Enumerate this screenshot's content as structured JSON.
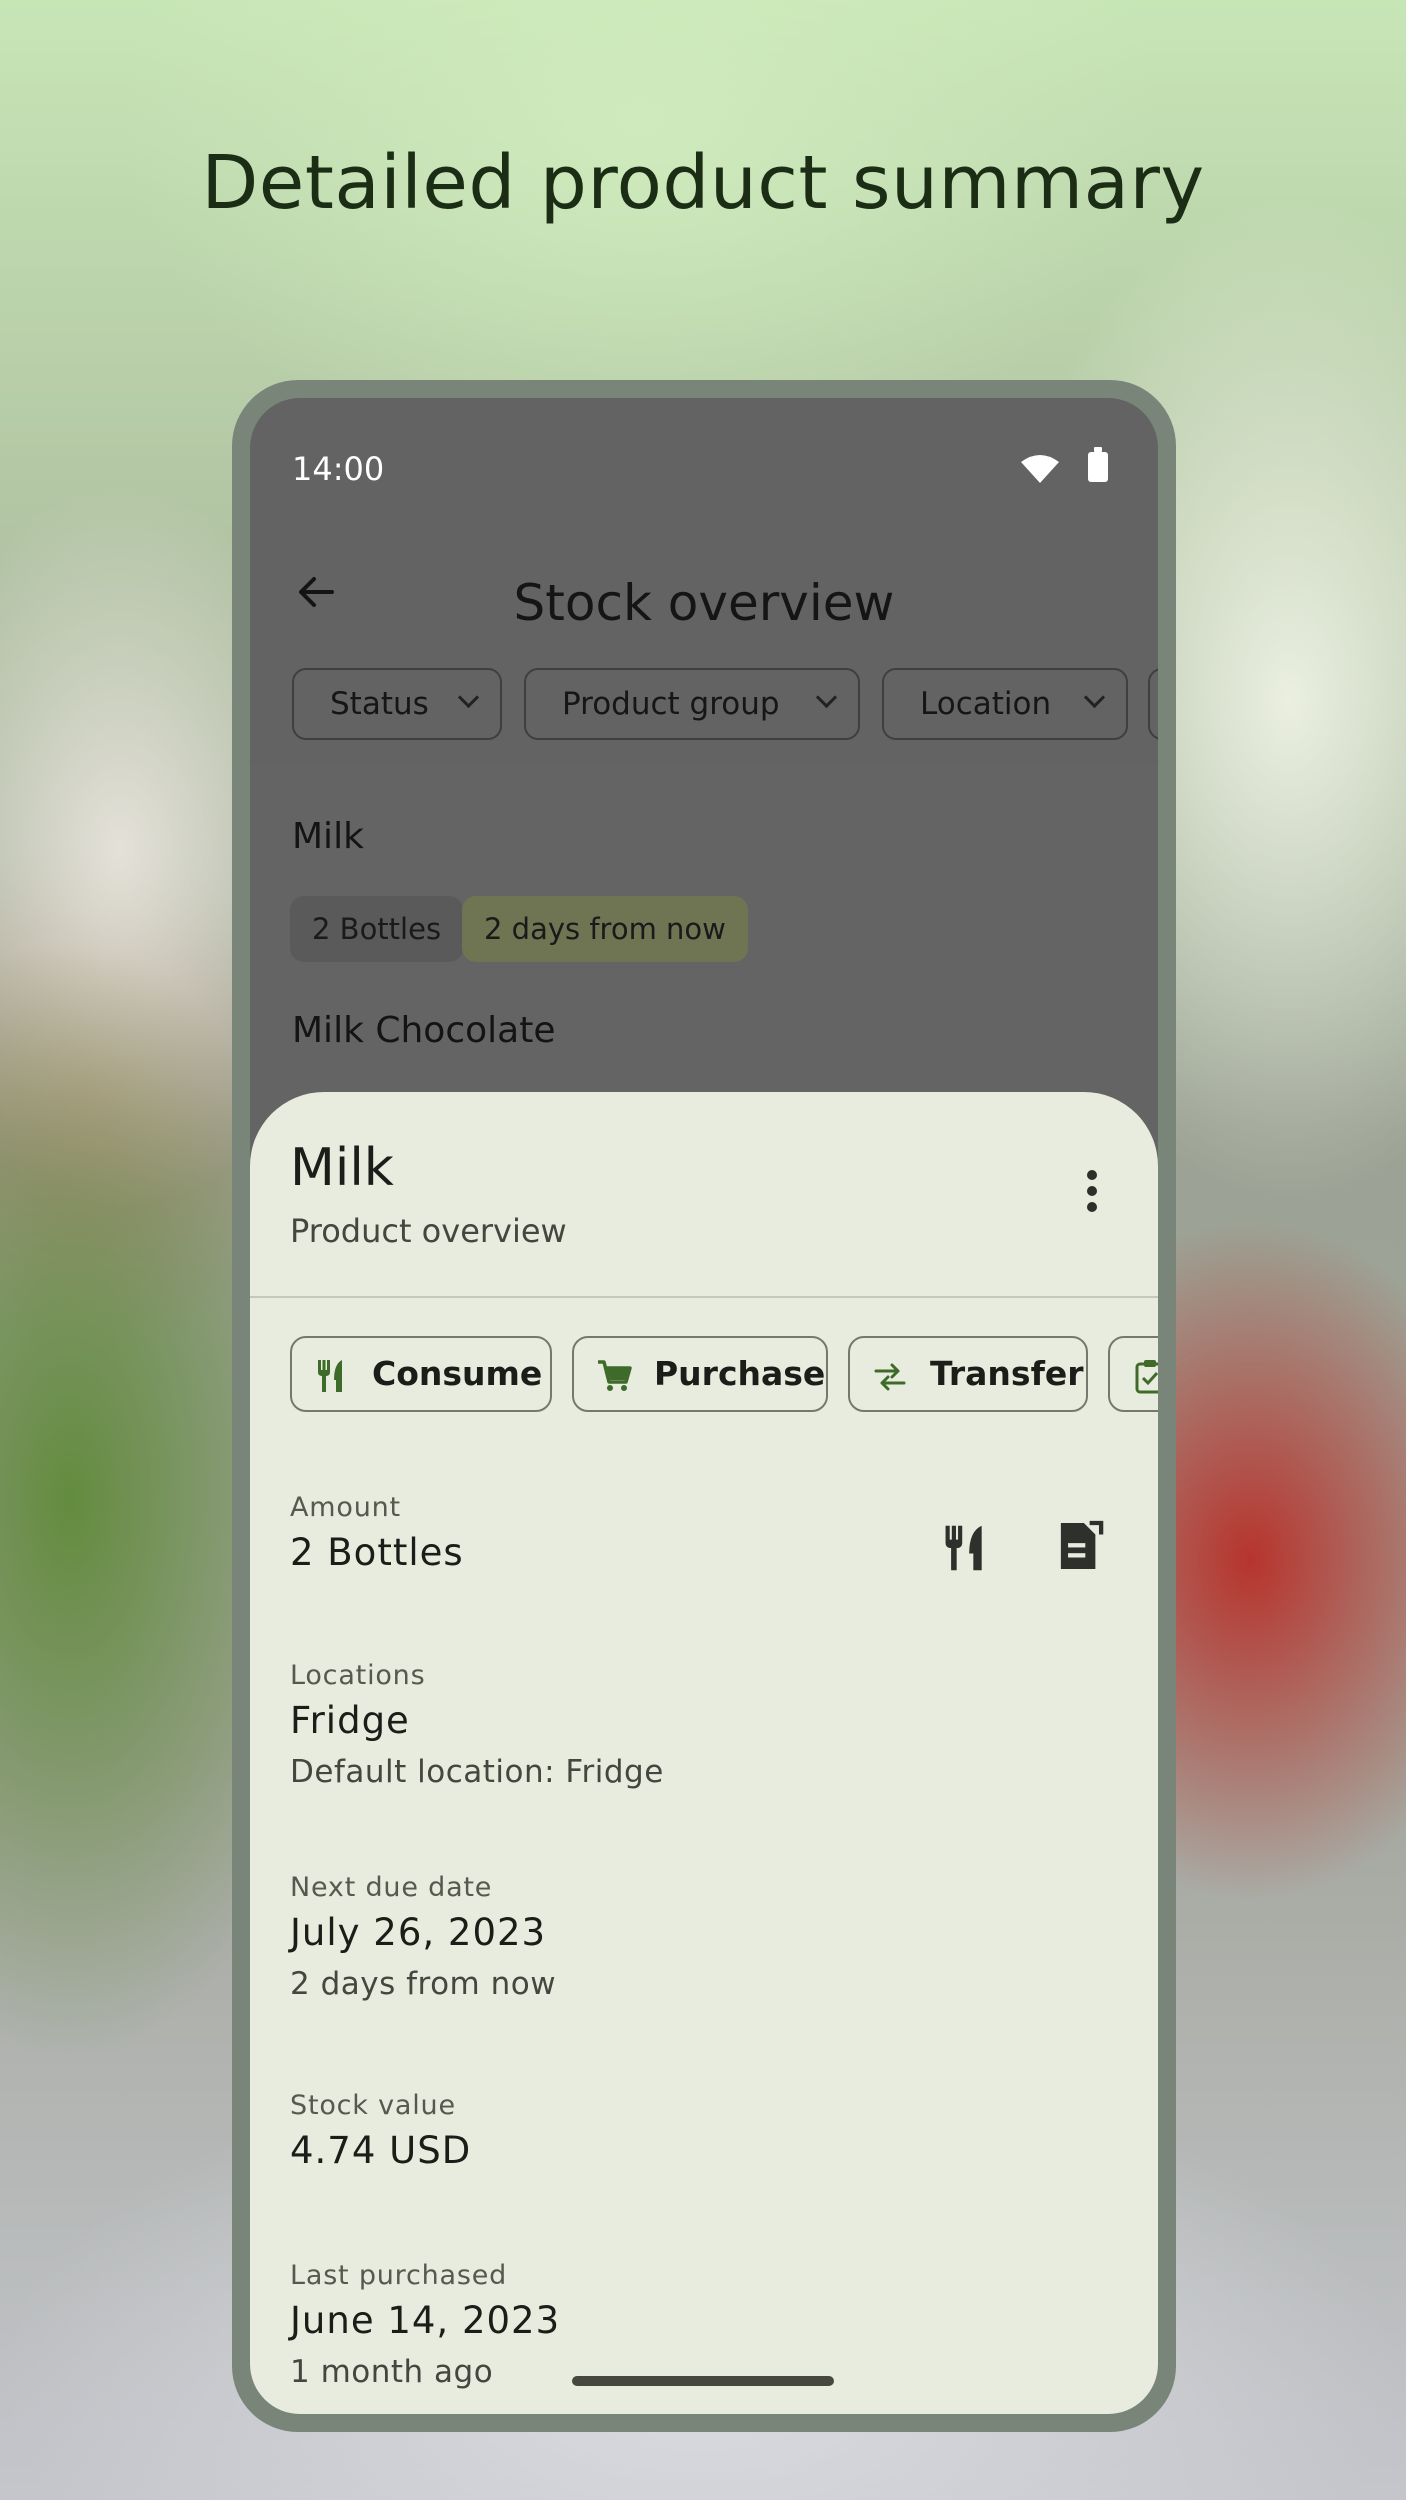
{
  "headline": "Detailed product summary",
  "status_bar": {
    "time": "14:00"
  },
  "app_bar": {
    "title": "Stock overview"
  },
  "filters": [
    {
      "label": "Status"
    },
    {
      "label": "Product group"
    },
    {
      "label": "Location"
    }
  ],
  "list": [
    {
      "name": "Milk",
      "amount": "2 Bottles",
      "due": "2 days from now"
    },
    {
      "name": "Milk Chocolate"
    }
  ],
  "sheet": {
    "title": "Milk",
    "subtitle": "Product overview",
    "actions": [
      {
        "label": "Consume",
        "icon": "fork-knife-icon"
      },
      {
        "label": "Purchase",
        "icon": "cart-icon"
      },
      {
        "label": "Transfer",
        "icon": "swap-arrows-icon"
      },
      {
        "label": "",
        "icon": "clipboard-check-icon"
      }
    ],
    "fields": {
      "amount": {
        "label": "Amount",
        "value": "2 Bottles"
      },
      "locations": {
        "label": "Locations",
        "value": "Fridge",
        "sub": "Default location: Fridge"
      },
      "next_due": {
        "label": "Next due date",
        "value": "July 26, 2023",
        "sub": "2 days from now"
      },
      "stock_value": {
        "label": "Stock value",
        "value": "4.74 USD"
      },
      "last_purchased": {
        "label": "Last purchased",
        "value": "June 14, 2023",
        "sub": "1 month ago"
      }
    }
  },
  "colors": {
    "sheet_bg": "#e7ecdf",
    "dimmed_bg": "#636363",
    "icon_green": "#3f6b2a",
    "due_tag": "#6f7453"
  }
}
